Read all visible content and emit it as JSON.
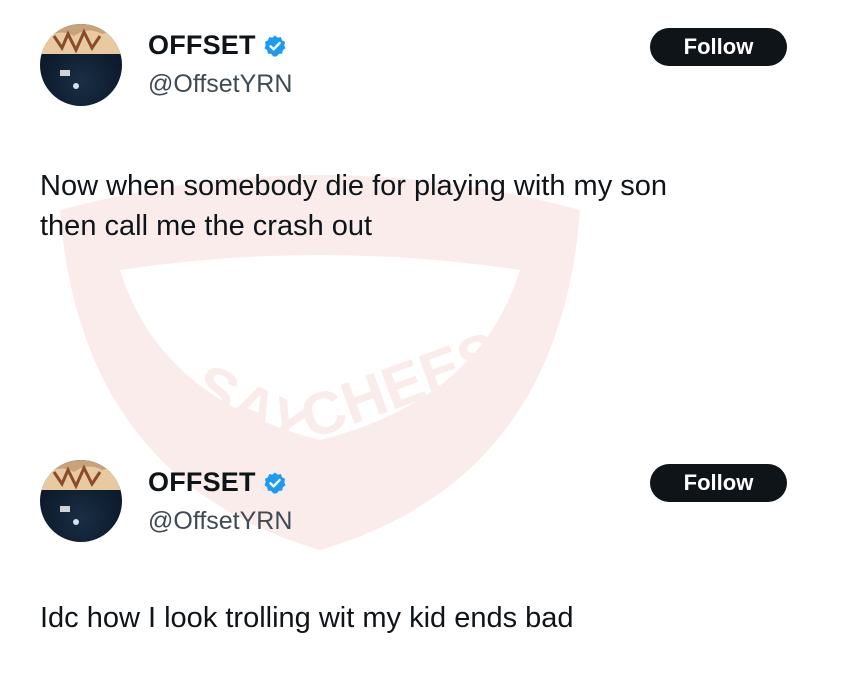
{
  "watermark": {
    "line1": "SAY",
    "line2": "CHEESE"
  },
  "tweets": [
    {
      "author_name": "OFFSET",
      "handle": "@OffsetYRN",
      "follow_label": "Follow",
      "text_lines": [
        "Now when somebody die for playing with my son",
        "then call me the crash out"
      ]
    },
    {
      "author_name": "OFFSET",
      "handle": "@OffsetYRN",
      "follow_label": "Follow",
      "text_lines": [
        "Idc how I look trolling wit my kid ends bad"
      ]
    }
  ],
  "colors": {
    "verified": "#1d9bf0",
    "button_bg": "#0f1419",
    "text": "#0f1419",
    "handle": "#3f4a55",
    "watermark_red": "#c0392b"
  },
  "icons": [
    "verified-badge-icon",
    "avatar-image"
  ]
}
